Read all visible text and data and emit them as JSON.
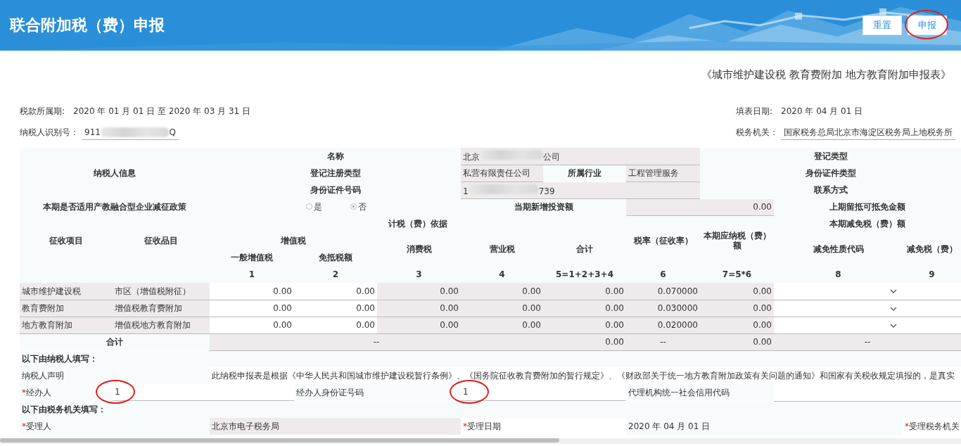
{
  "header": {
    "title": "联合附加税（费）申报",
    "buttons": [
      {
        "label": "重置",
        "circled": false
      },
      {
        "label": "申报",
        "circled": true
      }
    ]
  },
  "report_title": "《城市维护建设税 教育费附加 地方教育附加申报表》",
  "period": {
    "label": "税款所属期:",
    "value": "2020 年   01 月  01 日 至 2020 年   03 月  31 日"
  },
  "fill_date": {
    "label": "填表日期:",
    "value": "2020 年   04 月  01 日"
  },
  "taxpayer_id": {
    "label": "纳税人识别号：",
    "prefix": "911",
    "suffix": "Q"
  },
  "tax_office": {
    "label": "税务机关：",
    "value": "国家税务总局北京市海淀区税务局上地税务所"
  },
  "taxpayer_info": {
    "section": "纳税人信息",
    "name_label": "名称",
    "name_prefix": "北京",
    "name_suffix": "公司",
    "reg_type_label": "登记注册类型",
    "reg_type": "私营有限责任公司",
    "industry_label": "所属行业",
    "industry": "工程管理服务",
    "id_label": "身份证件号码",
    "id_prefix": "1",
    "id_suffix": "739",
    "right_labels": [
      "登记类型",
      "身份证件类型",
      "联系方式"
    ]
  },
  "policy": {
    "label": "本期是否适用产教融合型企业减征政策",
    "options": [
      {
        "label": "是",
        "selected": false
      },
      {
        "label": "否",
        "selected": true
      }
    ],
    "investment_label": "当期新增投资额",
    "investment": "0.00",
    "carryover_label": "上期留抵可抵免金额"
  },
  "headers": {
    "item": "征收项目",
    "subitem": "征收品目",
    "basis": "计税（费）依据",
    "vat": "增值税",
    "general_vat": "一般增值税",
    "exempt": "免抵税额",
    "consumption": "消费税",
    "business": "营业税",
    "sum": "合计",
    "rate": "税率（征收率）",
    "payable": "本期应纳税（费）额",
    "relief": "本期减免税（费）额",
    "relief_code": "减免性质代码",
    "relief_amount": "减免税（费）",
    "numbers": [
      "1",
      "2",
      "3",
      "4",
      "5=1+2+3+4",
      "6",
      "7=5*6",
      "8",
      "9"
    ]
  },
  "rows": [
    {
      "item": "城市维护建设税",
      "subitem": "市区（增值税附征）",
      "values": [
        "0.00",
        "0.00",
        "0.00",
        "0.00",
        "0.00",
        "0.070000",
        "0.00"
      ]
    },
    {
      "item": "教育费附加",
      "subitem": "增值税教育费附加",
      "values": [
        "0.00",
        "0.00",
        "0.00",
        "0.00",
        "0.00",
        "0.030000",
        "0.00"
      ]
    },
    {
      "item": "地方教育附加",
      "subitem": "增值税地方教育附加",
      "values": [
        "0.00",
        "0.00",
        "0.00",
        "0.00",
        "0.00",
        "0.020000",
        "0.00"
      ]
    }
  ],
  "total": {
    "label": "合计",
    "basis": "--",
    "sum": "0.00",
    "rate": "--",
    "payable": "0.00",
    "relief": "--"
  },
  "taxpayer_section": {
    "title": "以下由纳税人填写：",
    "declaration_label": "纳税人声明",
    "declaration": "此纳税申报表是根据《中华人民共和国城市维护建设税暂行条例》、《国务院征收教育费附加的暂行规定》、《财政部关于统一地方教育附加政策有关问题的通知》和国家有关税收规定填报的，是真实",
    "required_mark": "*",
    "agent_label": "经办人",
    "agent": "1",
    "agent_circled": true,
    "agent_id_label": "经办人身份证号码",
    "agent_id": "1",
    "agent_id_circled": true,
    "agency_label": "代理机构统一社会信用代码"
  },
  "office_section": {
    "title": "以下由税务机关填写：",
    "receiver_label": "受理人",
    "receiver": "北京市电子税务局",
    "date_label": "受理日期",
    "date": "2020 年   04 月  01 日",
    "office_label": "受理税务机关"
  }
}
